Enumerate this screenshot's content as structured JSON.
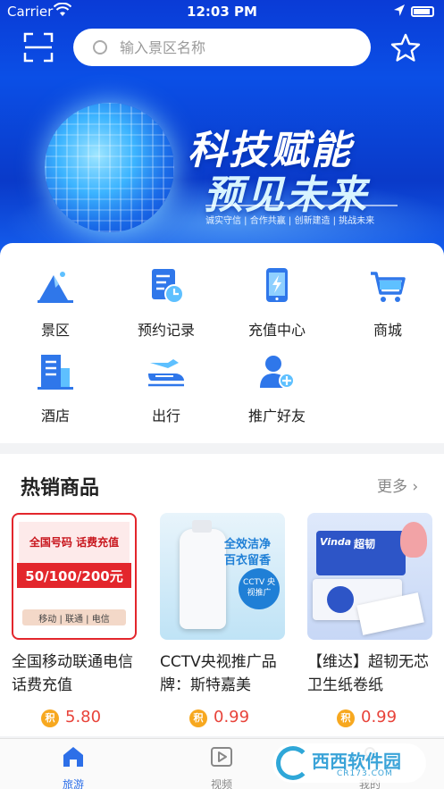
{
  "status_bar": {
    "carrier": "Carrier",
    "time": "12:03 PM"
  },
  "search": {
    "placeholder": "输入景区名称"
  },
  "banner": {
    "headline1": "科技赋能",
    "headline2": "预见未来",
    "tagline": "诚实守信 | 合作共赢 | 创新建造 | 挑战未来"
  },
  "menu": [
    {
      "label": "景区",
      "icon": "mountain-icon"
    },
    {
      "label": "预约记录",
      "icon": "booking-record-icon"
    },
    {
      "label": "充值中心",
      "icon": "recharge-icon"
    },
    {
      "label": "商城",
      "icon": "cart-icon"
    },
    {
      "label": "酒店",
      "icon": "hotel-icon"
    },
    {
      "label": "出行",
      "icon": "train-icon"
    },
    {
      "label": "推广好友",
      "icon": "add-friend-icon"
    }
  ],
  "hot": {
    "title": "热销商品",
    "more": "更多",
    "products": [
      {
        "name": "全国移动联通电信话费充值",
        "badge": "积",
        "price": "5.80",
        "img_text": {
          "top": "全国号码  话费充值",
          "mid": "50/100/200元",
          "bottom": "移动 | 联通 | 电信"
        }
      },
      {
        "name": "CCTV央视推广品牌：斯特嘉美",
        "badge": "积",
        "price": "0.99",
        "img_text": {
          "top": "全效洁净",
          "mid": "百衣留香",
          "bottom": "CCTV 央视推广"
        }
      },
      {
        "name": "【维达】超韧无芯卫生纸卷纸",
        "badge": "积",
        "price": "0.99",
        "img_text": {
          "top": "Vinda",
          "mid": "超韧",
          "bottom": ""
        }
      }
    ]
  },
  "tabbar": [
    {
      "label": "旅游",
      "active": true
    },
    {
      "label": "视频",
      "active": false
    },
    {
      "label": "我的",
      "active": false
    }
  ],
  "watermark": {
    "text": "西西软件园",
    "sub": "CR173.COM"
  },
  "colors": {
    "accent": "#2d6fe8",
    "price": "#e8433a",
    "badge": "#f7a81f",
    "banner": "#0b4fe6"
  }
}
